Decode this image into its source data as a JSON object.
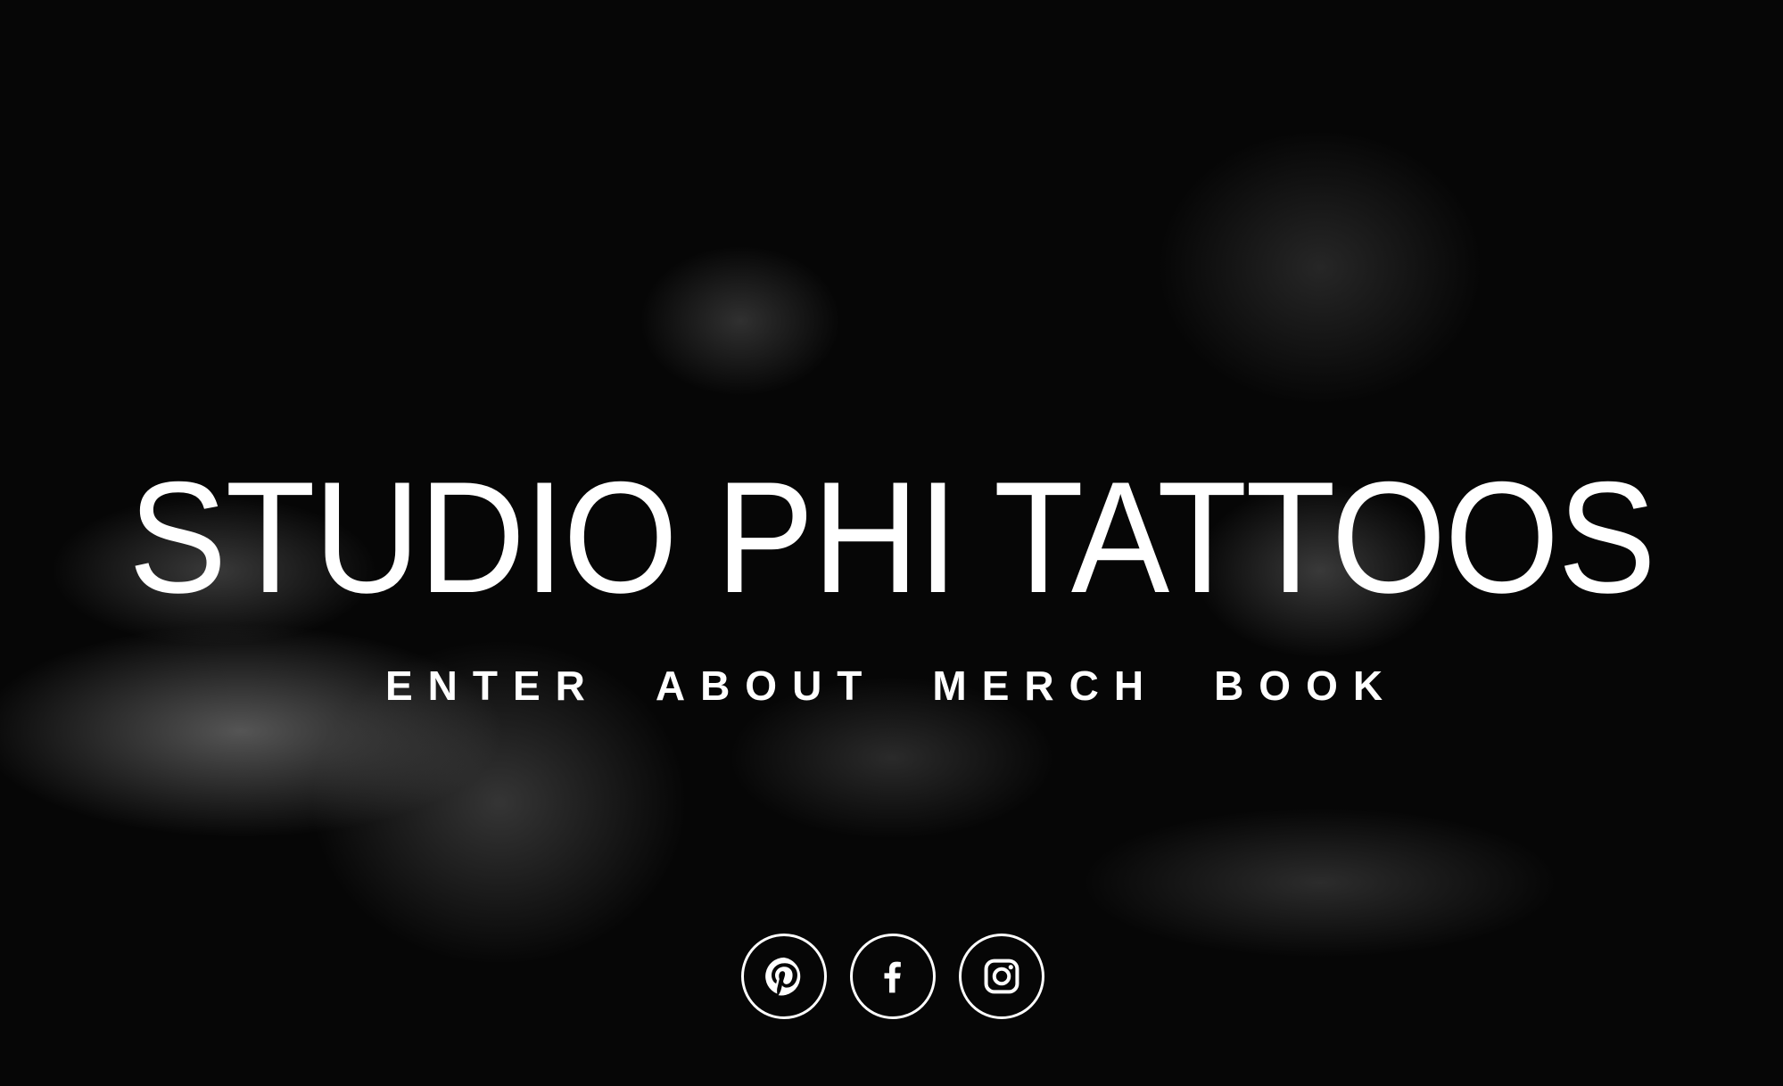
{
  "site": {
    "title": "STUDIO PHI TATTOOS"
  },
  "nav": [
    {
      "label": "ENTER"
    },
    {
      "label": "ABOUT"
    },
    {
      "label": "MERCH"
    },
    {
      "label": "BOOK"
    }
  ],
  "social": [
    {
      "icon": "pinterest-icon"
    },
    {
      "icon": "facebook-icon"
    },
    {
      "icon": "instagram-icon"
    }
  ],
  "colors": {
    "text": "#ffffff",
    "background": "#050505"
  }
}
